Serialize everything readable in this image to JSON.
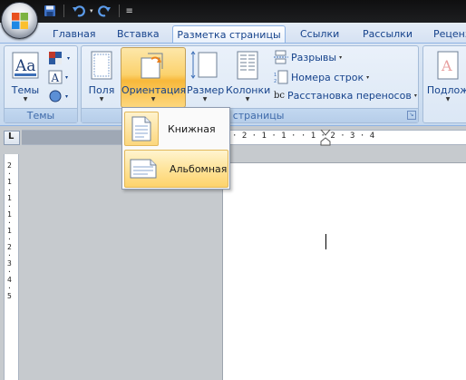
{
  "quick_access": {
    "icons": [
      "save-icon",
      "undo-icon",
      "redo-icon"
    ],
    "more_symbol": "▾",
    "customize_symbol": "≡"
  },
  "tabs": [
    {
      "label": "Главная",
      "active": false
    },
    {
      "label": "Вставка",
      "active": false
    },
    {
      "label": "Разметка страницы",
      "active": true
    },
    {
      "label": "Ссылки",
      "active": false
    },
    {
      "label": "Рассылки",
      "active": false
    },
    {
      "label": "Реценз",
      "active": false
    }
  ],
  "ribbon": {
    "themes_group": {
      "label": "Темы",
      "themes_button": "Темы"
    },
    "page_setup_group": {
      "label": "Параметры страницы",
      "visible_label": "ры страницы",
      "margins": "Поля",
      "orientation": "Ориентация",
      "size": "Размер",
      "columns": "Колонки",
      "breaks": "Разрывы",
      "line_numbers": "Номера строк",
      "hyphenation": "Расстановка переносов",
      "hyphen_icon_text": "bc"
    },
    "next_group": {
      "button": "Подлож"
    }
  },
  "orientation_menu": {
    "items": [
      {
        "label": "Книжная",
        "highlighted": false
      },
      {
        "label": "Альбомная",
        "highlighted": true
      }
    ]
  },
  "ruler": {
    "corner_symbol": "L",
    "horizontal_text": "· 2 · 1 · 1 ·   · 1 · 2 · 3 · 4",
    "vertical_text": "2·1·1·1·1·2·3·4·5"
  },
  "colors": {
    "accent": "#f8b83a",
    "tab_text": "#15428b",
    "ribbon_bg": "#cfdff1"
  }
}
